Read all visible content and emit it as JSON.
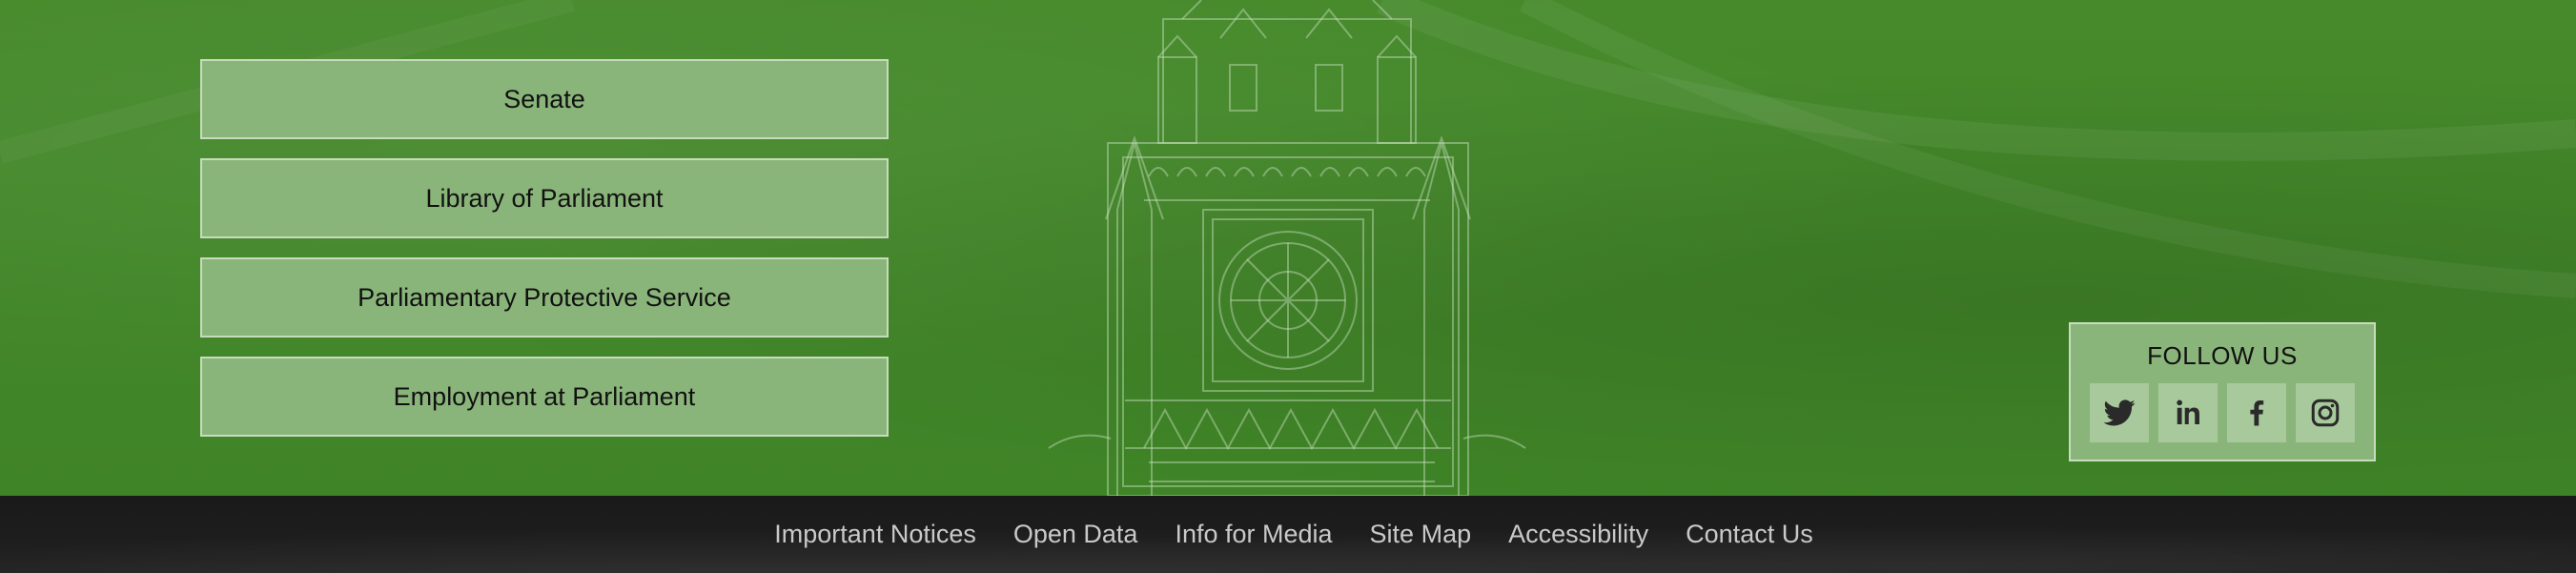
{
  "links": [
    {
      "label": "Senate"
    },
    {
      "label": "Library of Parliament"
    },
    {
      "label": "Parliamentary Protective Service"
    },
    {
      "label": "Employment at Parliament"
    }
  ],
  "follow": {
    "title": "FOLLOW US",
    "icons": [
      "twitter-icon",
      "linkedin-icon",
      "facebook-icon",
      "instagram-icon"
    ]
  },
  "footer": {
    "links": [
      {
        "label": "Important Notices"
      },
      {
        "label": "Open Data"
      },
      {
        "label": "Info for Media"
      },
      {
        "label": "Site Map"
      },
      {
        "label": "Accessibility"
      },
      {
        "label": "Contact Us"
      }
    ]
  },
  "colors": {
    "background_green": "#3f8427",
    "button_fill": "#8ab57a",
    "button_border": "#c7dcbd",
    "footer_bg": "#1a1a1a",
    "footer_text": "#c9c9c9"
  }
}
